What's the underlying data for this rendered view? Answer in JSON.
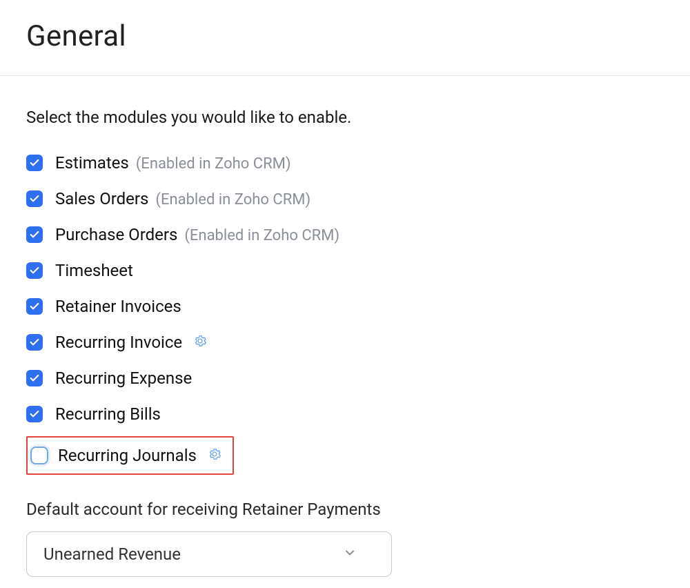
{
  "header": {
    "title": "General"
  },
  "intro": "Select the modules you would like to enable.",
  "crm_note": "(Enabled in Zoho CRM)",
  "modules": {
    "estimates": {
      "label": "Estimates",
      "checked": true,
      "crm": true
    },
    "sales_orders": {
      "label": "Sales Orders",
      "checked": true,
      "crm": true
    },
    "purchase_orders": {
      "label": "Purchase Orders",
      "checked": true,
      "crm": true
    },
    "timesheet": {
      "label": "Timesheet",
      "checked": true
    },
    "retainer_invoices": {
      "label": "Retainer Invoices",
      "checked": true
    },
    "recurring_invoice": {
      "label": "Recurring Invoice",
      "checked": true,
      "gear": true
    },
    "recurring_expense": {
      "label": "Recurring Expense",
      "checked": true
    },
    "recurring_bills": {
      "label": "Recurring Bills",
      "checked": true
    },
    "recurring_journals": {
      "label": "Recurring Journals",
      "checked": false,
      "gear": true,
      "highlighted": true
    }
  },
  "retainer_section": {
    "label": "Default account for receiving Retainer Payments",
    "selected": "Unearned Revenue"
  }
}
